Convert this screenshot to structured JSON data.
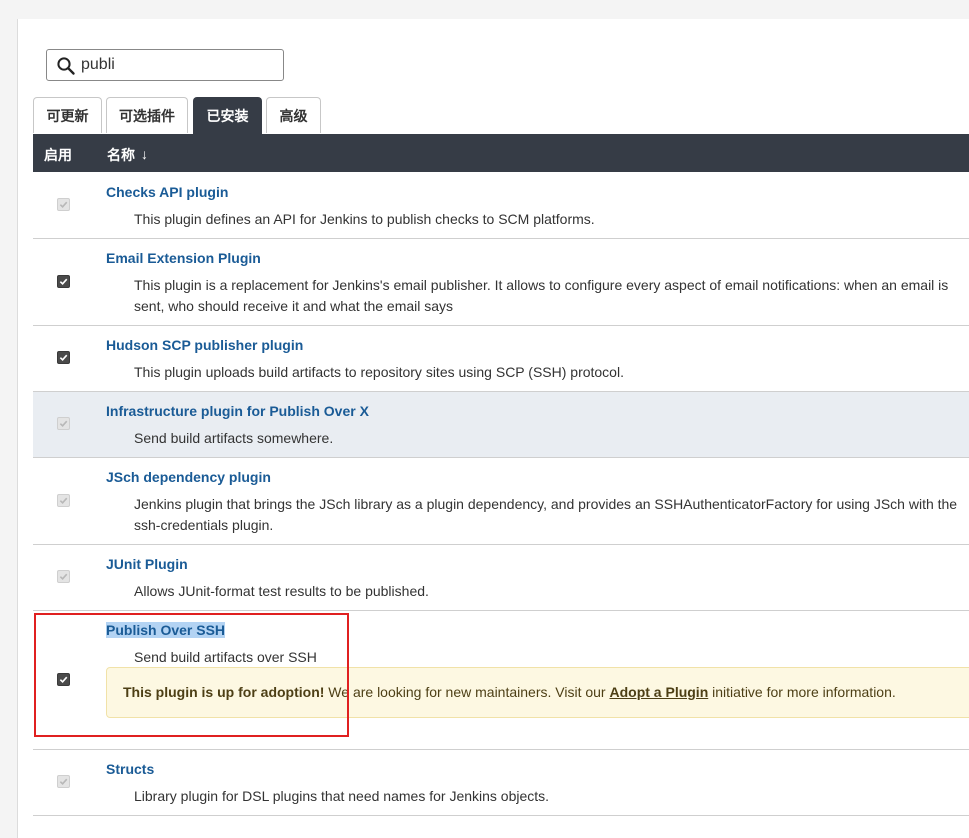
{
  "search": {
    "value": "publi"
  },
  "tabs": [
    {
      "label": "可更新"
    },
    {
      "label": "可选插件"
    },
    {
      "label": "已安装",
      "active": true
    },
    {
      "label": "高级"
    }
  ],
  "table": {
    "col_enabled": "启用",
    "col_name": "名称",
    "sort_arrow": "↓"
  },
  "plugins": [
    {
      "name": "Checks API plugin",
      "desc": "This plugin defines an API for Jenkins to publish checks to SCM platforms.",
      "checkbox": "disabled"
    },
    {
      "name": "Email Extension Plugin",
      "desc": "This plugin is a replacement for Jenkins's email publisher. It allows to configure every aspect of email notifications: when an email is sent, who should receive it and what the email says",
      "checkbox": "checked"
    },
    {
      "name": "Hudson SCP publisher plugin",
      "desc": "This plugin uploads build artifacts to repository sites using SCP (SSH) protocol.",
      "checkbox": "checked"
    },
    {
      "name": "Infrastructure plugin for Publish Over X",
      "desc": "Send build artifacts somewhere.",
      "checkbox": "disabled"
    },
    {
      "name": "JSch dependency plugin",
      "desc": "Jenkins plugin that brings the JSch library as a plugin dependency, and provides an SSHAuthenticatorFactory for using JSch with the ssh-credentials plugin.",
      "checkbox": "disabled"
    },
    {
      "name": "JUnit Plugin",
      "desc": "Allows JUnit-format test results to be published.",
      "checkbox": "disabled"
    },
    {
      "name": "Publish Over SSH",
      "desc": "Send build artifacts over SSH",
      "checkbox": "checked",
      "adoption": {
        "bold": "This plugin is up for adoption!",
        "text1": " We are looking for new maintainers. Visit our ",
        "link": "Adopt a Plugin",
        "text2": " initiative for more information."
      }
    },
    {
      "name": "Structs",
      "desc": "Library plugin for DSL plugins that need names for Jenkins objects.",
      "checkbox": "disabled"
    }
  ],
  "colors": {
    "header_bg": "#363c46",
    "link": "#1a5b96",
    "highlight_row": "#e9edf2",
    "adopt_bg": "#fdf8e2",
    "annotation": "#e02020"
  }
}
